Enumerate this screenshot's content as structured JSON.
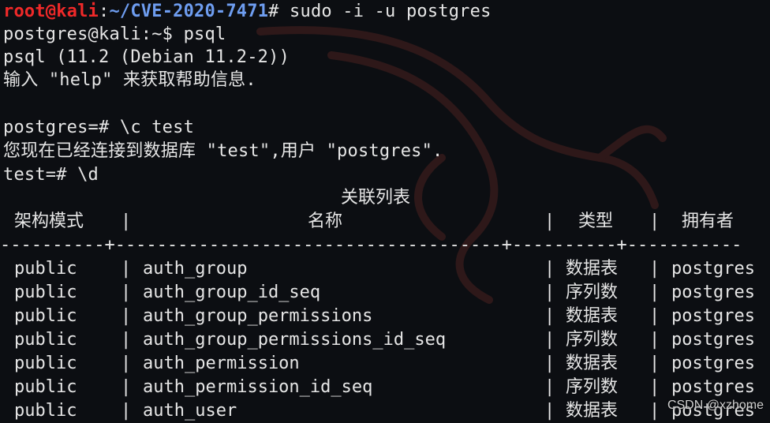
{
  "prompt": {
    "user_host": "root@kali",
    "colon": ":",
    "path": "~/CVE-2020-7471",
    "hash": "#",
    "command": " sudo -i -u postgres"
  },
  "lines": {
    "l2": "postgres@kali:~$ psql",
    "l3": "psql (11.2 (Debian 11.2-2))",
    "l4": "输入 \"help\" 来获取帮助信息.",
    "l6": "postgres=# \\c test",
    "l7": "您现在已经连接到数据库 \"test\",用户 \"postgres\".",
    "l8": "test=# \\d"
  },
  "table": {
    "caption": "关联列表",
    "headers": {
      "schema": "架构模式",
      "name": "名称",
      "type": "类型",
      "owner": "拥有者"
    },
    "divider": "----------+-------------------------------------+----------+-----------",
    "rows": [
      {
        "schema": "public",
        "name": "auth_group",
        "type": "数据表",
        "owner": "postgres"
      },
      {
        "schema": "public",
        "name": "auth_group_id_seq",
        "type": "序列数",
        "owner": "postgres"
      },
      {
        "schema": "public",
        "name": "auth_group_permissions",
        "type": "数据表",
        "owner": "postgres"
      },
      {
        "schema": "public",
        "name": "auth_group_permissions_id_seq",
        "type": "序列数",
        "owner": "postgres"
      },
      {
        "schema": "public",
        "name": "auth_permission",
        "type": "数据表",
        "owner": "postgres"
      },
      {
        "schema": "public",
        "name": "auth_permission_id_seq",
        "type": "序列数",
        "owner": "postgres"
      },
      {
        "schema": "public",
        "name": "auth_user",
        "type": "数据表",
        "owner": "postgres"
      }
    ]
  },
  "watermark": "CSDN @xzhome",
  "colors": {
    "background": "#0c0e12",
    "text": "#e6e6e6",
    "root": "#ef2929",
    "path": "#6e9df0",
    "dragon": "#3a1a1a"
  }
}
